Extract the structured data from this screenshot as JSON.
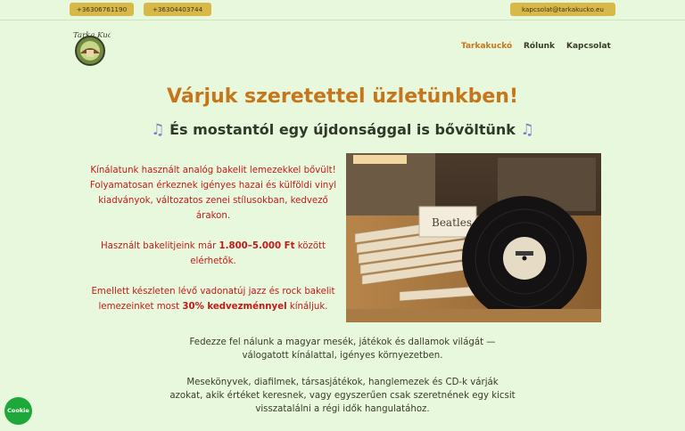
{
  "topbar": {
    "phone1": "+36306761190",
    "phone2": "+36304403744",
    "email": "kapcsolat@tarkakucko.eu"
  },
  "logo": {
    "text": "Tarka Kuckó"
  },
  "nav": {
    "home": "Tarkakuckó",
    "about": "Rólunk",
    "contact": "Kapcsolat"
  },
  "main": {
    "title": "Várjuk szeretettel üzletünkben!",
    "subtitle": "És mostantól egy újdonsággal is bővöltünk",
    "promo": {
      "p1": "Kínálatunk használt analóg bakelit lemezekkel bővült! Folyamatosan érkeznek igényes hazai és külföldi vinyl kiadványok, változatos zenei stílusokban, kedvező árakon.",
      "p2_before": "Használt bakelitjeink már ",
      "p2_price": "1.800–5.000 Ft",
      "p2_after": " között elérhetők.",
      "p3_before": "Emellett készleten lévő vadonatúj jazz és rock bakelit lemezeinket most ",
      "p3_discount": "30% kedvezménnyel",
      "p3_after": " kínáljuk."
    },
    "photo": {
      "label": "Beatles"
    },
    "bottom": {
      "p1": "Fedezze fel nálunk a magyar mesék, játékok és dallamok világát — válogatott kínálattal, igényes környezetben.",
      "p2": "Mesekönyvek, diafilmek, társasjátékok, hanglemezek és CD-k várják azokat, akik értéket keresnek, vagy egyszerűen csak szeretnének egy kicsit visszatalálni a régi idők hangulatához."
    }
  },
  "cookie": {
    "label": "Cookie"
  },
  "icons": {
    "music": "music-note-icon"
  }
}
